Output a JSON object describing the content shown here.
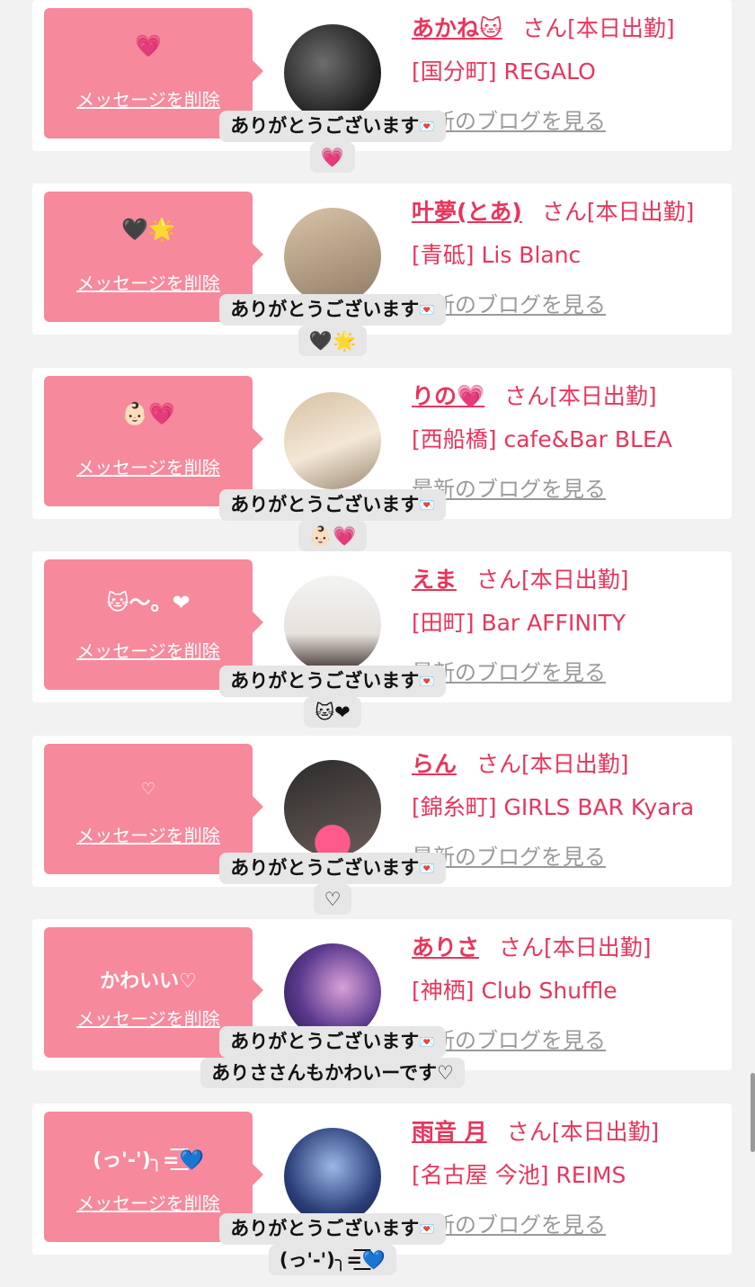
{
  "common": {
    "san": "さん",
    "status": "[本日出勤]",
    "delete_label": "メッセージを削除",
    "blog_label": "最新のブログを見る",
    "thanks": "ありがとうございます"
  },
  "cards": [
    {
      "message": "💗",
      "name": "あかね🐱",
      "shop": "[国分町] REGALO",
      "reply": [
        "💗"
      ]
    },
    {
      "message": "🖤🌟",
      "name": "叶夢(とあ)",
      "shop": "[青砥] Lis Blanc",
      "reply": [
        "🖤🌟"
      ]
    },
    {
      "message": "👶🏻💗",
      "name": "りの💗",
      "shop": "[西船橋] cafe&Bar BLEA",
      "reply": [
        "👶🏻💗"
      ]
    },
    {
      "message": "🐱〜。❤",
      "name": "えま",
      "shop": "[田町] Bar AFFINITY",
      "reply": [
        "🐱❤"
      ]
    },
    {
      "message": "♡",
      "name": "らん",
      "shop": "[錦糸町] GIRLS BAR Kyara",
      "reply": [
        "♡"
      ]
    },
    {
      "message": "かわいい♡",
      "name": "ありさ",
      "shop": "[神栖] Club Shuffle",
      "reply": [
        "ありささんもかわいーです♡"
      ]
    },
    {
      "message": "(っ'-')╮=͟͟͞͞💙",
      "name": "雨音 月",
      "shop": "[名古屋 今池] REIMS",
      "reply": [
        "(っ'-')╮=͟͟͞͞💙"
      ]
    }
  ]
}
